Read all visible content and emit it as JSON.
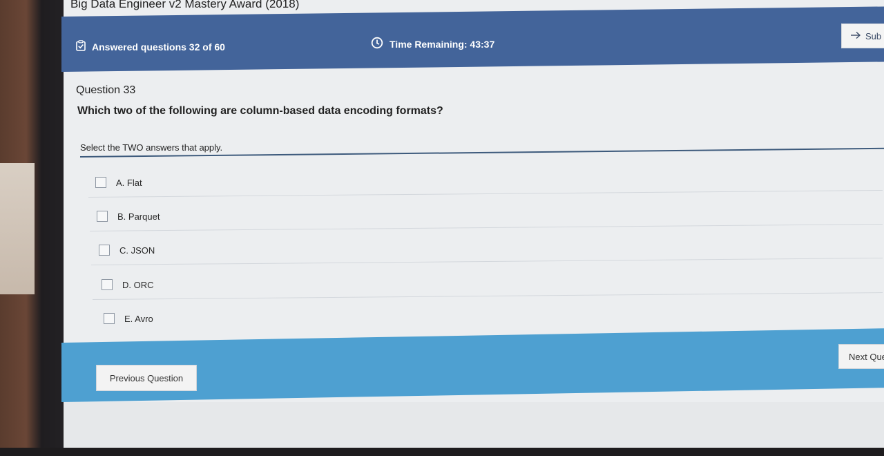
{
  "app": {
    "title": "Big Data Engineer v2 Mastery Award (2018)"
  },
  "status": {
    "answered_label": "Answered questions 32 of 60",
    "answered_icon": "clipboard-check-icon",
    "time_label": "Time Remaining: 43:37",
    "time_icon": "clock-icon",
    "submit_label": "Sub",
    "submit_icon": "arrow-right-icon"
  },
  "question": {
    "number_label": "Question 33",
    "text": "Which two of the following are column-based data encoding formats?",
    "instruction": "Select the TWO answers that apply.",
    "options": [
      {
        "label": "A.  Flat",
        "checked": false
      },
      {
        "label": "B.  Parquet",
        "checked": false
      },
      {
        "label": "C.  JSON",
        "checked": false
      },
      {
        "label": "D.  ORC",
        "checked": false
      },
      {
        "label": "E.  Avro",
        "checked": false
      }
    ]
  },
  "navigation": {
    "previous_label": "Previous Question",
    "next_label": "Next Que"
  },
  "colors": {
    "status_bar": "#43649a",
    "nav_bar": "#4ea0d1",
    "rule": "#3d5a7c"
  }
}
